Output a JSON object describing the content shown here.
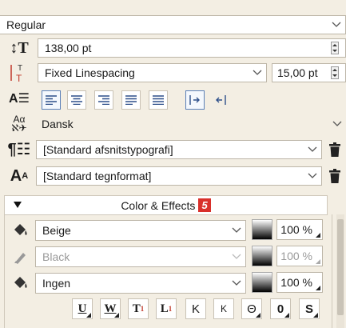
{
  "font_style": {
    "value": "Regular"
  },
  "font_size": {
    "value": "138,00 pt"
  },
  "linespacing": {
    "mode": "Fixed Linespacing",
    "value": "15,00 pt"
  },
  "alignment": {
    "buttons": [
      "align-left",
      "align-center",
      "align-right",
      "align-justify",
      "align-justify-all",
      "indent-start",
      "indent-end"
    ],
    "active": [
      "align-left",
      "indent-start"
    ]
  },
  "language": {
    "value": "Dansk"
  },
  "paragraph_style": {
    "value": "[Standard afsnitstypografi]"
  },
  "character_style": {
    "value": "[Standard tegnformat]"
  },
  "color_effects": {
    "title": "Color & Effects",
    "badge": "5",
    "rows": [
      {
        "color": "Beige",
        "opacity": "100 %",
        "enabled": true
      },
      {
        "color": "Black",
        "opacity": "100 %",
        "enabled": false
      },
      {
        "color": "Ingen",
        "opacity": "100 %",
        "enabled": true
      }
    ]
  },
  "format_buttons": [
    "U",
    "W",
    "T",
    "L",
    "K",
    "K",
    "Θ",
    "0",
    "S"
  ],
  "colors": {
    "accent": "#d9302b",
    "active_border": "#5a7fb8",
    "background": "#f3eee3"
  }
}
